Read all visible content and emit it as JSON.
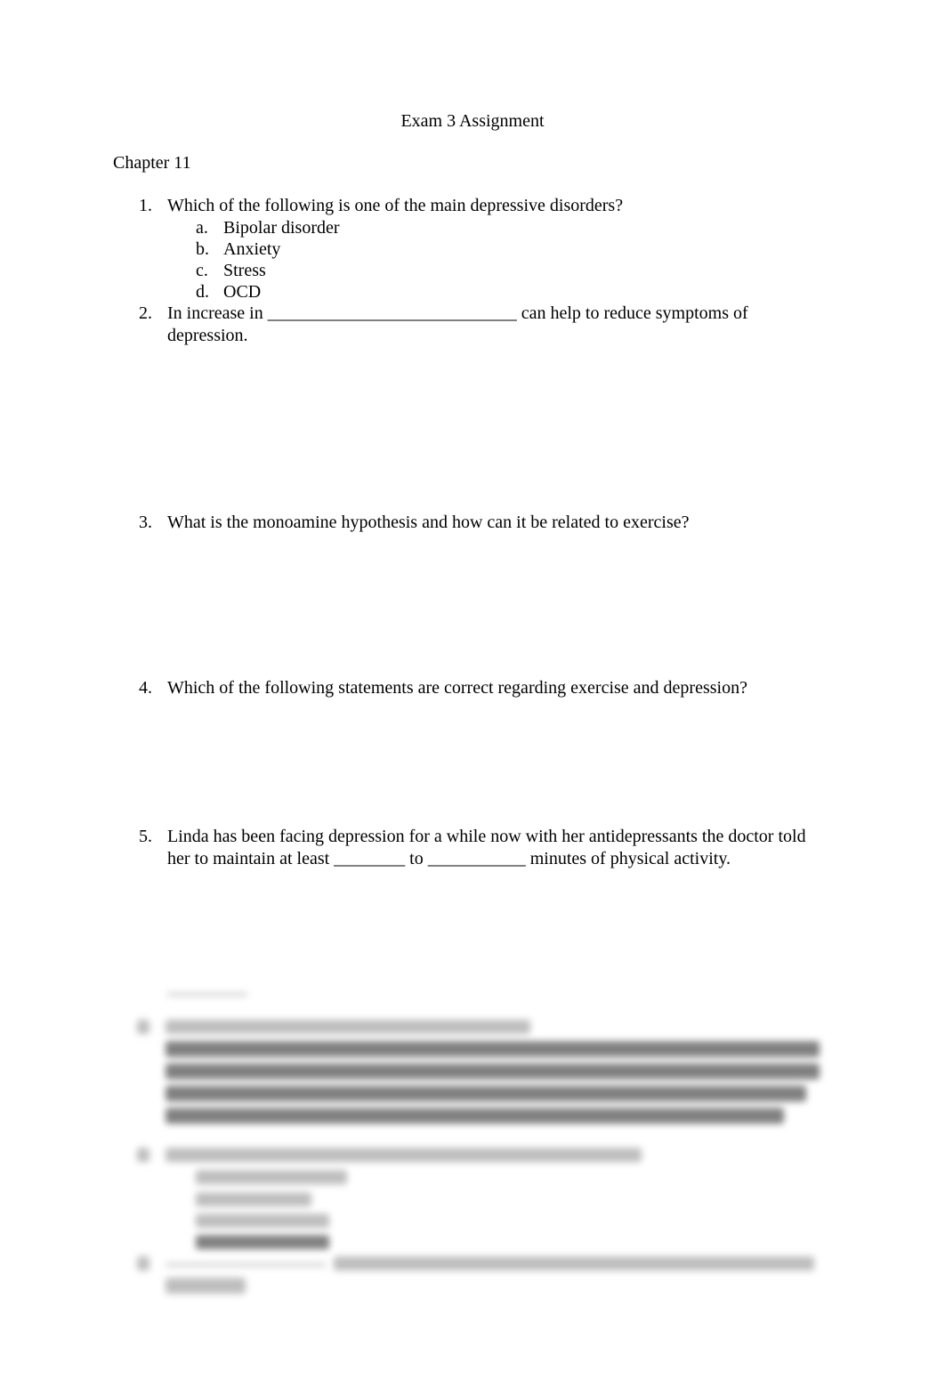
{
  "document": {
    "title": "Exam 3 Assignment",
    "chapter": "Chapter 11",
    "questions": [
      {
        "number": "1.",
        "text": "Which of the following is one of the main depressive disorders?",
        "options": [
          {
            "letter": "a.",
            "text": "Bipolar disorder"
          },
          {
            "letter": "b.",
            "text": "Anxiety"
          },
          {
            "letter": "c.",
            "text": "Stress"
          },
          {
            "letter": "d.",
            "text": "OCD"
          }
        ]
      },
      {
        "number": "2.",
        "line1": "In increase in ____________________________ can help to reduce symptoms of",
        "line2": "depression."
      },
      {
        "number": "3.",
        "text": "What is the monoamine hypothesis and how can it be related to exercise?"
      },
      {
        "number": "4.",
        "text": "Which of the following statements are correct regarding exercise and depression?"
      },
      {
        "number": "5.",
        "line1": "Linda has been facing depression for a while now with her antidepressants the doctor told",
        "line2": "her to maintain at least ________ to ___________ minutes of physical activity."
      }
    ],
    "blurred_section": {
      "description": "obscured preview content (questions 6–8)"
    }
  }
}
